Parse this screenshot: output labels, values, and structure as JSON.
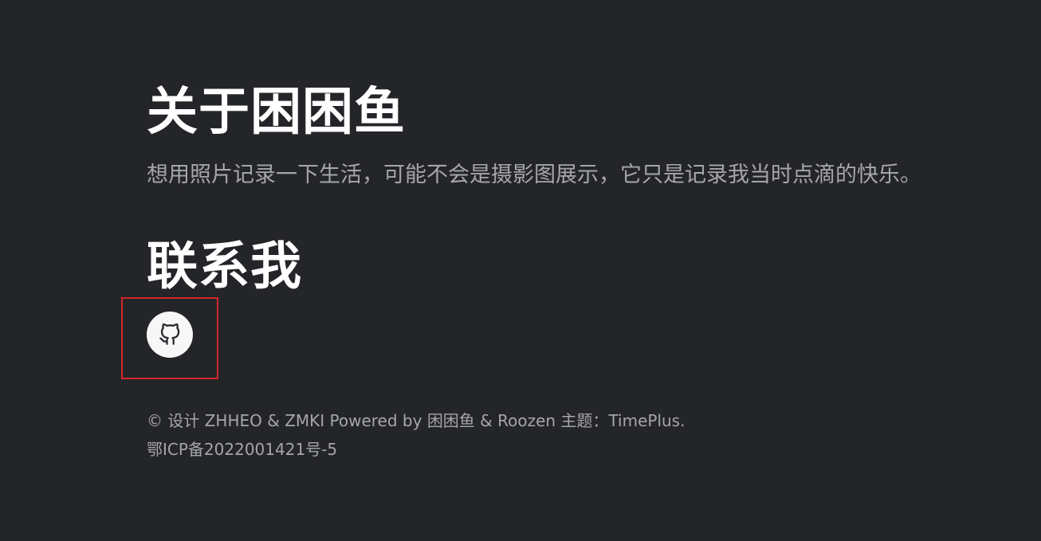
{
  "about": {
    "title": "关于困困鱼",
    "description": "想用照片记录一下生活，可能不会是摄影图展示，它只是记录我当时点滴的快乐。"
  },
  "contact": {
    "title": "联系我",
    "links": [
      {
        "icon": "github-icon",
        "label": "GitHub"
      }
    ]
  },
  "footer": {
    "copyright_prefix": "© 设计 ",
    "designers": "ZHHEO & ZMKI",
    "powered_by": " Powered by ",
    "authors": "困困鱼 & Roozen",
    "theme_prefix": " 主题：",
    "theme_name": "TimePlus.",
    "icp": "鄂ICP备2022001421号-5"
  },
  "colors": {
    "background": "#242529",
    "heading": "#ffffff",
    "muted_text": "#a5a6aa",
    "icon_bg": "#f7f7f8",
    "highlight": "#d42a2a"
  }
}
